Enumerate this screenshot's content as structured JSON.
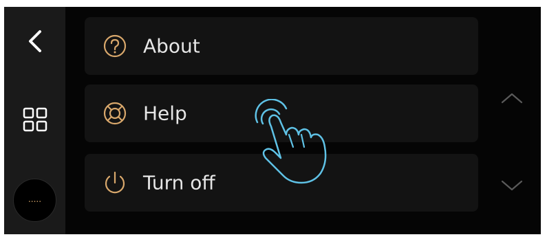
{
  "sidebar": {
    "back_icon": "chevron-left-icon",
    "grid_icon": "grid-icon",
    "more_label": "....."
  },
  "menu": {
    "items": [
      {
        "label": "About",
        "icon": "question-circle-icon"
      },
      {
        "label": "Help",
        "icon": "lifebuoy-icon"
      },
      {
        "label": "Turn off",
        "icon": "power-icon"
      }
    ]
  },
  "scroll": {
    "up_icon": "chevron-up-icon",
    "down_icon": "chevron-down-icon"
  },
  "overlay": {
    "gesture_icon": "tap-hand-icon"
  },
  "colors": {
    "accent": "#d9a86c",
    "gesture": "#5fc2e6",
    "background": "#050505",
    "sidebar": "#1a1a1a",
    "item_bg": "#131313",
    "text": "#e6e6e6"
  }
}
